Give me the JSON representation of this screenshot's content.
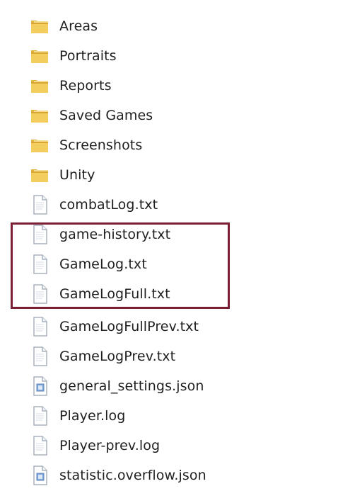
{
  "colors": {
    "highlight": "#7a1f34",
    "folder": "#f2c84b",
    "text_file_border": "#9aa5b3",
    "json_file_accent": "#7fa6d8"
  },
  "items": [
    {
      "label": "Areas",
      "icon": "folder-icon"
    },
    {
      "label": "Portraits",
      "icon": "folder-icon"
    },
    {
      "label": "Reports",
      "icon": "folder-icon"
    },
    {
      "label": "Saved Games",
      "icon": "folder-icon"
    },
    {
      "label": "Screenshots",
      "icon": "folder-icon"
    },
    {
      "label": "Unity",
      "icon": "folder-icon"
    },
    {
      "label": "combatLog.txt",
      "icon": "text-file-icon"
    },
    {
      "label": "game-history.txt",
      "icon": "text-file-icon"
    },
    {
      "label": "GameLog.txt",
      "icon": "text-file-icon"
    },
    {
      "label": "GameLogFull.txt",
      "icon": "text-file-icon"
    },
    {
      "label": "GameLogFullPrev.txt",
      "icon": "text-file-icon"
    },
    {
      "label": "GameLogPrev.txt",
      "icon": "text-file-icon"
    },
    {
      "label": "general_settings.json",
      "icon": "json-file-icon"
    },
    {
      "label": "Player.log",
      "icon": "text-file-icon"
    },
    {
      "label": "Player-prev.log",
      "icon": "text-file-icon"
    },
    {
      "label": "statistic.overflow.json",
      "icon": "json-file-icon"
    }
  ]
}
